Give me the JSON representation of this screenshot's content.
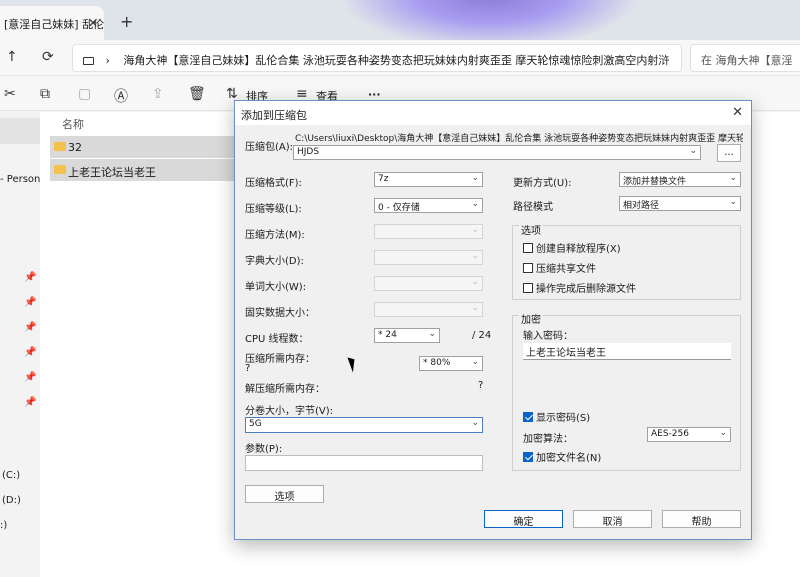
{
  "browser": {
    "tab_title": "[意淫自己妹妹] 乱伦",
    "tab_close": "✕",
    "new_tab": "+",
    "address": "海角大神【意淫自己妹妹】乱伦合集 泳池玩耍各种姿势变态把玩妹妹内射爽歪歪 摩天轮惊魂惊险刺激高空内射浒",
    "search_placeholder": "在 海角大神【意淫"
  },
  "toolbar": {
    "sort_label": "排序",
    "view_label": "查看",
    "more_label": "···"
  },
  "nav": {
    "person_label": "- Person",
    "drive_c": "(C:)",
    "drive_d": "(D:)",
    "drive_e": ":)"
  },
  "filelist": {
    "column_name": "名称",
    "rows": [
      "32",
      "上老王论坛当老王"
    ]
  },
  "dialog": {
    "title": "添加到压缩包",
    "archive_label": "压缩包(A):",
    "archive_path": "C:\\Users\\liuxi\\Desktop\\海角大神【意淫自己妹妹】乱伦合集 泳池玩耍各种姿势变态把玩妹妹内射爽歪歪 摩天轮",
    "archive_name": "HJDS",
    "browse_label": "...",
    "format_label": "压缩格式(F):",
    "format_value": "7z",
    "level_label": "压缩等级(L):",
    "level_value": "0 - 仅存储",
    "method_label": "压缩方法(M):",
    "dict_label": "字典大小(D):",
    "word_label": "单词大小(W):",
    "solid_label": "固实数据大小：",
    "cpu_label": "CPU 线程数：",
    "cpu_value": "* 24",
    "cpu_total": "/ 24",
    "mem_comp_label": "压缩所需内存：",
    "mem_comp_q": "?",
    "mem_comp_value": "* 80%",
    "mem_decomp_label": "解压缩所需内存：",
    "mem_decomp_q": "?",
    "split_label": "分卷大小，字节(V):",
    "split_value": "5G",
    "params_label": "参数(P):",
    "options_button": "选项",
    "update_label": "更新方式(U):",
    "update_value": "添加并替换文件",
    "path_label": "路径模式",
    "path_value": "相对路径",
    "options_group": "选项",
    "opt_sfx": "创建自释放程序(X)",
    "opt_shared": "压缩共享文件",
    "opt_delete": "操作完成后删除源文件",
    "encrypt_group": "加密",
    "password_label": "输入密码：",
    "password_value": "上老王论坛当老王",
    "show_password": "显示密码(S)",
    "algo_label": "加密算法：",
    "algo_value": "AES-256",
    "encrypt_names": "加密文件名(N)",
    "ok": "确定",
    "cancel": "取消",
    "help": "帮助"
  }
}
